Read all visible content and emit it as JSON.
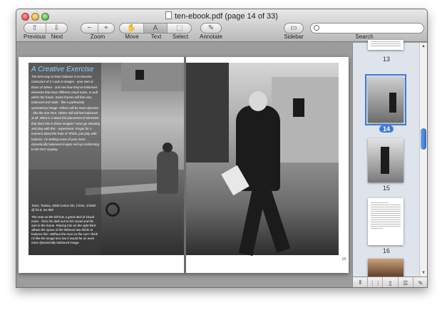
{
  "window": {
    "title": "ten-ebook.pdf (page 14 of 33)"
  },
  "toolbar": {
    "previous_label": "Previous",
    "next_label": "Next",
    "zoom_label": "Zoom",
    "zoom_out_glyph": "−",
    "zoom_in_glyph": "+",
    "move_label": "Move",
    "text_label": "Text",
    "select_label": "Select",
    "annotate_label": "Annotate",
    "sidebar_label": "Sidebar",
    "search_label": "Search",
    "text_tool_glyph": "A",
    "active_tool": "text"
  },
  "search": {
    "value": ""
  },
  "document": {
    "article_title": "A Creative Exercise",
    "article_body": "The best way to learn balance is to become conscious of it. Look at images - your own or those of others - and see how they've balanced elements that have different visual mass, or pull, within the frame. Some frames will feel very balanced and static - like a particularly symmetrical image. Others will be more dynamic - like the one here. Others still will feel balanced at all. What is it about the placement of elements that does this in these images? Have go shooting and play with this - experiment. Forget for a moment about the Rule of Thirds, just play with balance. I'm betting some of your more dynamically balanced images end up conforming to the RoT anyway.",
    "caption_head": "Tunis, Tunisia, 2008 Canon 5D, 17mm, 1/1600 @ f/4.0, iso 800",
    "caption_body": "The man on the left has a great deal of visual mass - from his dark suit to his scowl and his size in the frame. Placing him on the right third allows the space of the leftmost two thirds to balance him. Without the man on the cart I think I'd like the image less but it would be an even more dynamically balanced image.",
    "page_number": "14"
  },
  "sidebar": {
    "thumbnails": [
      {
        "label": "13",
        "selected": false
      },
      {
        "label": "14",
        "selected": true
      },
      {
        "label": "15",
        "selected": false
      },
      {
        "label": "16",
        "selected": false
      }
    ],
    "bottom_icons": [
      "column-view-icon",
      "grid-view-icon",
      "thumbnail-view-icon",
      "list-view-icon",
      "annotations-icon"
    ]
  },
  "colors": {
    "accent": "#3d7bd6",
    "article_title": "#8fd3f5"
  }
}
